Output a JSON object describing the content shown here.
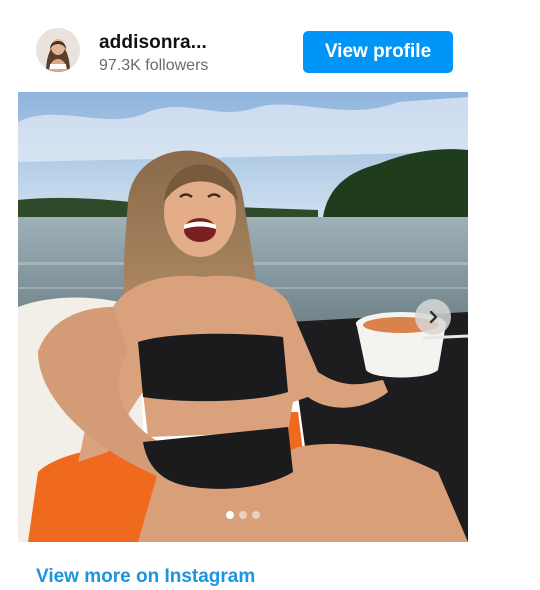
{
  "header": {
    "username": "addisonra...",
    "followers": "97.3K followers",
    "view_profile_label": "View profile"
  },
  "carousel": {
    "slide_count": 3,
    "active_index": 0
  },
  "footer": {
    "view_more_label": "View more on Instagram"
  },
  "colors": {
    "accent": "#0095f6",
    "link": "#1b95e0"
  },
  "icons": {
    "next": "chevron-right-icon"
  }
}
